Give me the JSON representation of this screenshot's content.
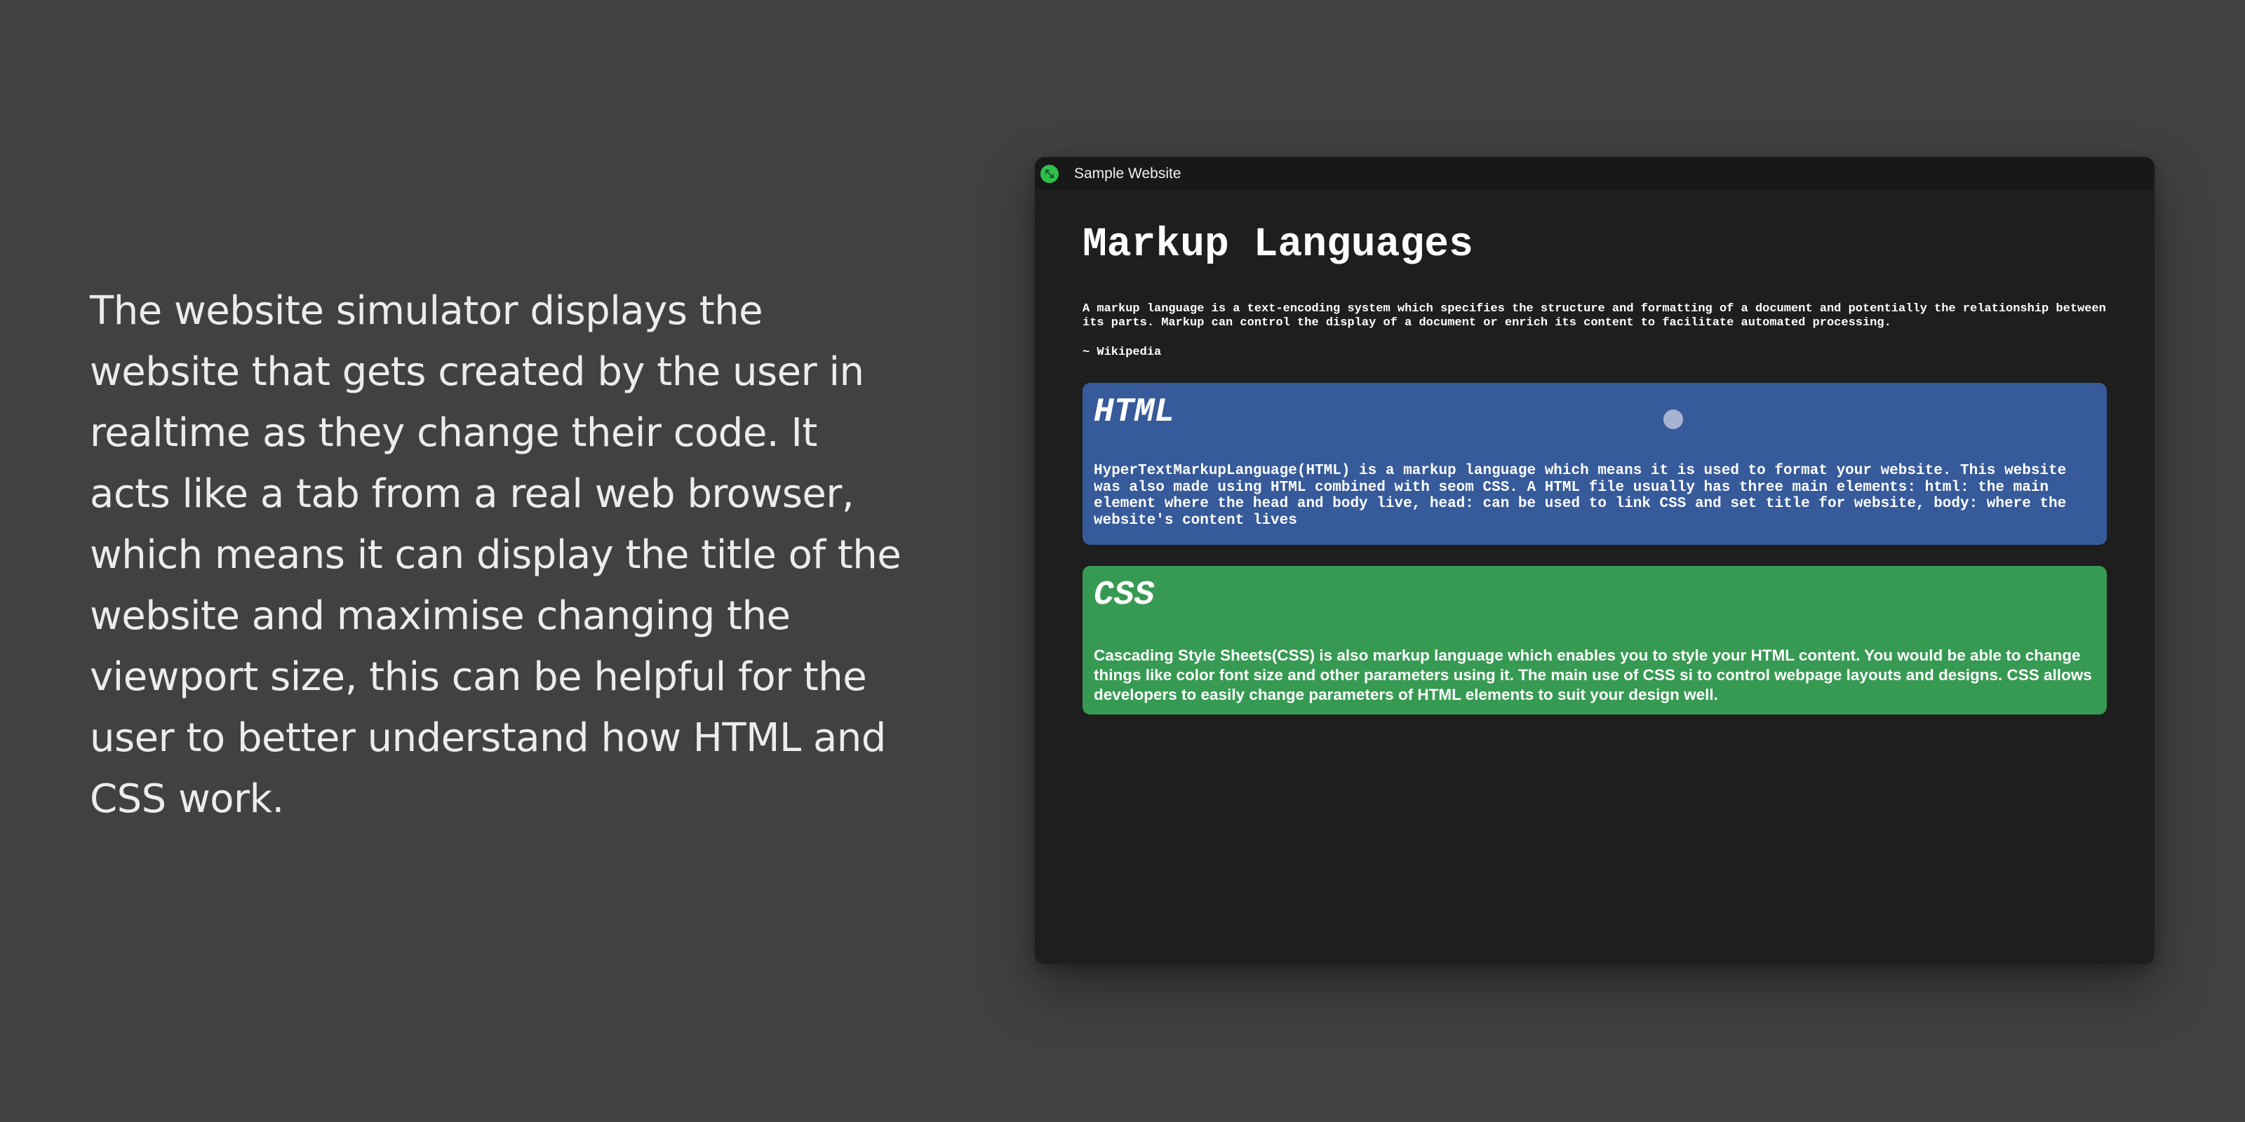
{
  "description": "The website simulator displays the website that gets created by the user in realtime as they change their code. It acts like a tab from a real web browser, which means it can display the title of the website and maximise changing the viewport size, this can be helpful for the user to better understand how HTML and CSS work.",
  "simulator": {
    "tab_title": "Sample Website",
    "maximize_icon": "expand-arrows-icon",
    "maximize_color": "#2fbf4a"
  },
  "page": {
    "heading": "Markup Languages",
    "intro": "A markup language is a text-encoding system which specifies the structure and formatting of a document and potentially the relationship between its parts. Markup can control the display of a document or enrich its content to facilitate automated processing.",
    "source": "~ Wikipedia",
    "cards": [
      {
        "title": "HTML",
        "body": "HyperTextMarkupLanguage(HTML) is a markup language which means it is used to format your website. This website was also made using HTML combined with seom CSS. A HTML file usually has three main elements: html: the main element where the head and body live, head: can be used to link CSS and set title for website, body: where the website's content lives",
        "color": "#365a9a"
      },
      {
        "title": "CSS",
        "body": "Cascading Style Sheets(CSS) is also markup language which enables you to style your HTML content. You would be able to change things like color font size and other parameters using it. The main use of CSS si to control webpage layouts and designs. CSS allows developers to easily change parameters of HTML elements to suit your design well.",
        "color": "#379a53"
      }
    ]
  }
}
